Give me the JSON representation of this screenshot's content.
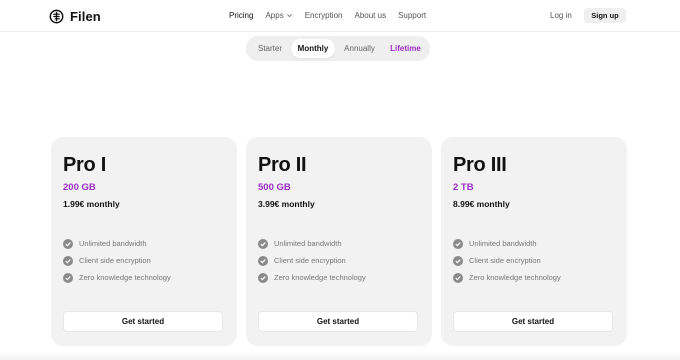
{
  "brand": {
    "name": "Filen"
  },
  "nav": {
    "links": [
      {
        "label": "Pricing",
        "active": true
      },
      {
        "label": "Apps",
        "has_dropdown": true
      },
      {
        "label": "Encryption"
      },
      {
        "label": "About us"
      },
      {
        "label": "Support"
      }
    ],
    "login": "Log in",
    "signup": "Sign up"
  },
  "billing_toggle": {
    "options": [
      "Starter",
      "Monthly",
      "Annually",
      "Lifetime"
    ],
    "selected": "Monthly"
  },
  "plans": [
    {
      "name": "Pro I",
      "storage": "200 GB",
      "price": "1.99€ monthly",
      "features": [
        "Unlimited bandwidth",
        "Client side encryption",
        "Zero knowledge technology"
      ],
      "cta": "Get started"
    },
    {
      "name": "Pro II",
      "storage": "500 GB",
      "price": "3.99€ monthly",
      "features": [
        "Unlimited bandwidth",
        "Client side encryption",
        "Zero knowledge technology"
      ],
      "cta": "Get started"
    },
    {
      "name": "Pro III",
      "storage": "2 TB",
      "price": "8.99€ monthly",
      "features": [
        "Unlimited bandwidth",
        "Client side encryption",
        "Zero knowledge technology"
      ],
      "cta": "Get started"
    }
  ],
  "colors": {
    "accent": "#9b2fc5",
    "card_bg": "#f2f2f2",
    "check_icon": "#8a8a8a"
  },
  "icons": {
    "logo": "filen-logo-icon",
    "dropdown": "chevron-down-icon",
    "feature": "check-circle-icon"
  }
}
